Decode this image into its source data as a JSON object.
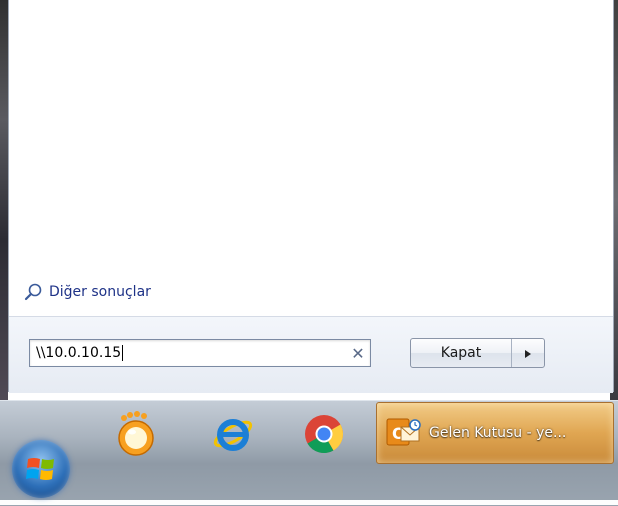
{
  "start_menu": {
    "more_results_label": "Diğer sonuçlar",
    "search_value": "\\\\10.0.10.15",
    "clear_icon": "close-icon",
    "shutdown_label": "Kapat",
    "shutdown_arrow_icon": "triangle-right-icon"
  },
  "taskbar": {
    "start_button_icon": "windows-logo-icon",
    "pinned": [
      {
        "name": "gom-player-icon"
      },
      {
        "name": "internet-explorer-icon"
      },
      {
        "name": "chrome-icon"
      }
    ],
    "active_task": {
      "icon": "outlook-icon",
      "label": "Gelen Kutusu - ye..."
    }
  },
  "colors": {
    "link": "#1e3287",
    "taskbar": "#a9b3be",
    "active_task": "#e0a652"
  }
}
